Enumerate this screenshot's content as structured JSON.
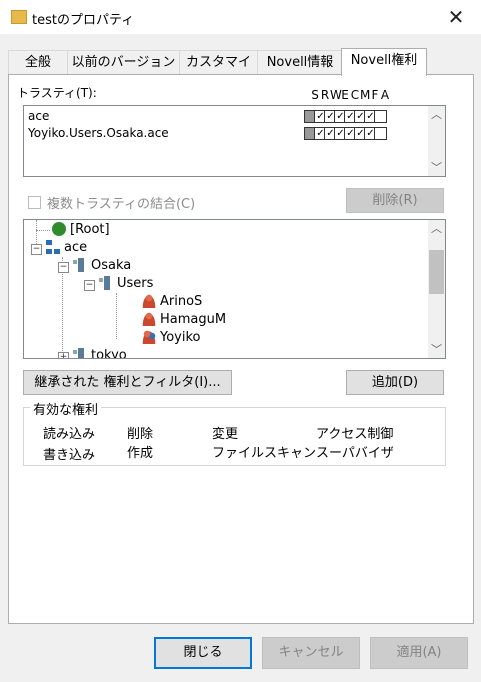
{
  "window": {
    "title": "testのプロパティ",
    "close_glyph": "✕"
  },
  "tabs": [
    {
      "label": "全般"
    },
    {
      "label": "以前のバージョン"
    },
    {
      "label": "カスタマイズ"
    },
    {
      "label": "Novell情報"
    },
    {
      "label": "Novell権利"
    }
  ],
  "trustees": {
    "label": "トラスティ(T):",
    "rights_header": [
      "S",
      "R",
      "W",
      "E",
      "C",
      "M",
      "F",
      "A"
    ],
    "rows": [
      {
        "name": "ace",
        "rights": [
          false,
          true,
          true,
          true,
          true,
          true,
          true,
          false
        ]
      },
      {
        "name": "Yoyiko.Users.Osaka.ace",
        "rights": [
          false,
          true,
          true,
          true,
          true,
          true,
          true,
          false
        ]
      }
    ]
  },
  "combine_trustees": {
    "label": "複数トラスティの結合(C)"
  },
  "buttons": {
    "delete": "削除(R)",
    "inherited": "継承された 権利とフィルタ(I)...",
    "add": "追加(D)",
    "close": "閉じる",
    "cancel": "キャンセル",
    "apply": "適用(A)"
  },
  "tree": {
    "nodes": [
      {
        "label": "[Root]",
        "icon": "globe-icon"
      },
      {
        "label": "ace",
        "icon": "tree-icon"
      },
      {
        "label": "Osaka",
        "icon": "ou-icon"
      },
      {
        "label": "Users",
        "icon": "ou-icon"
      },
      {
        "label": "ArinoS",
        "icon": "user-icon"
      },
      {
        "label": "HamaguM",
        "icon": "user-icon"
      },
      {
        "label": "Yoyiko",
        "icon": "user-group-icon"
      },
      {
        "label": "tokyo",
        "icon": "ou-icon"
      }
    ]
  },
  "effective_rights": {
    "title": "有効な権利",
    "items": [
      "読み込み",
      "削除",
      "変更",
      "アクセス制御",
      "書き込み",
      "作成",
      "ファイルスキャン",
      "スーパバイザ"
    ]
  },
  "colors": {
    "accent": "#0078d7",
    "folder": "#e8b84b"
  }
}
